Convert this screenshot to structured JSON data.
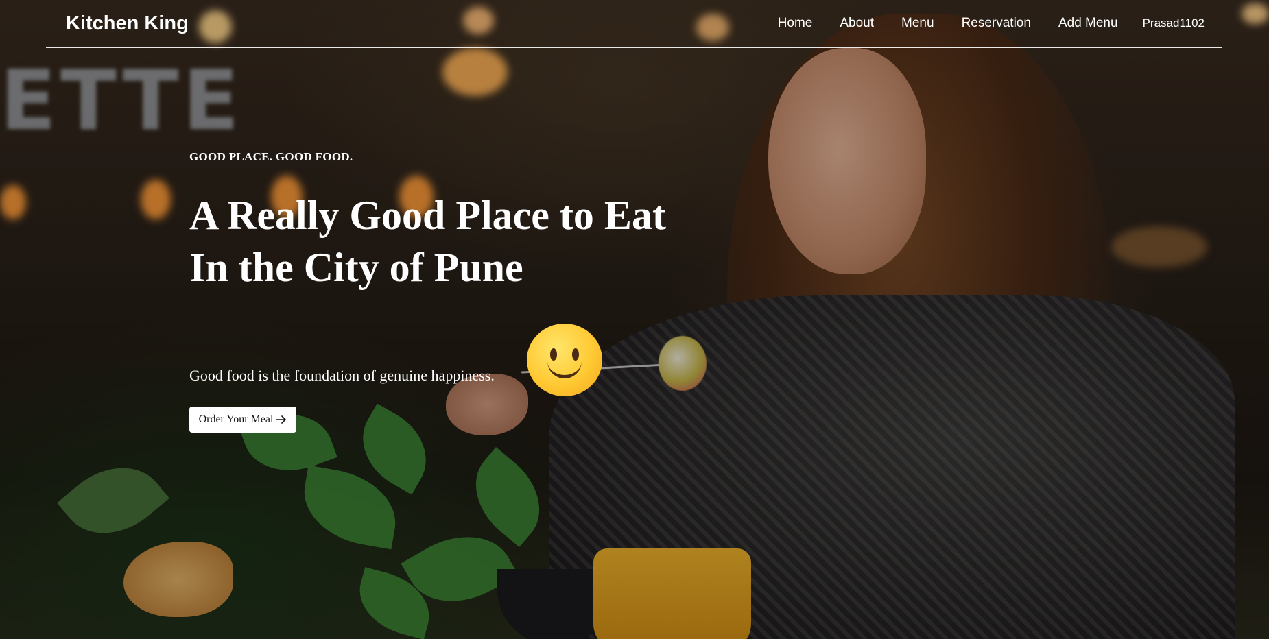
{
  "navbar": {
    "brand": "Kitchen King",
    "links": [
      "Home",
      "About",
      "Menu",
      "Reservation",
      "Add Menu"
    ],
    "user": "Prasad1102"
  },
  "hero": {
    "tagline": "GOOD PLACE. GOOD FOOD.",
    "headline_line1": "A Really Good Place to Eat",
    "headline_line2": "In the City of Pune",
    "subtitle": "Good food is the foundation of genuine happiness.",
    "cta_label": "Order Your Meal",
    "cta_icon": "arrow-right-icon",
    "emoji": "slightly-smiling-face"
  },
  "colors": {
    "text": "#ffffff",
    "button_bg": "#ffffff",
    "button_text": "#111111",
    "emoji": "#ffc933"
  }
}
